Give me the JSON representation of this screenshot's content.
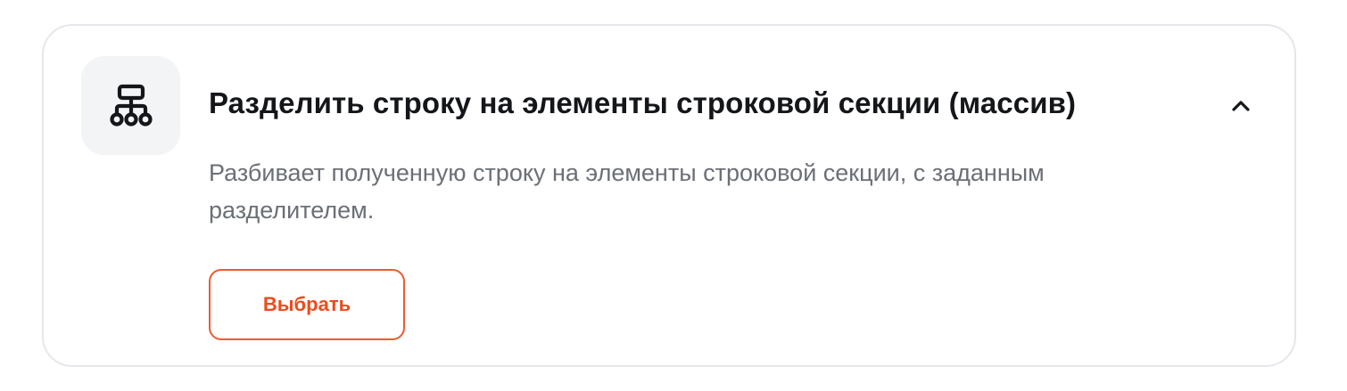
{
  "card": {
    "icon": "hierarchy-icon",
    "title": "Разделить строку на элементы строковой секции (массив)",
    "expanded": true,
    "collapse_icon": "chevron-up-icon",
    "description": "Разбивает полученную строку на элементы строковой секции, с заданным разделителем.",
    "select_label": "Выбрать"
  },
  "colors": {
    "accent": "#ef4a1c",
    "title": "#14161a",
    "description": "#6b6f76",
    "icon_tile_bg": "#f3f4f6",
    "border": "#e6e7eb"
  }
}
